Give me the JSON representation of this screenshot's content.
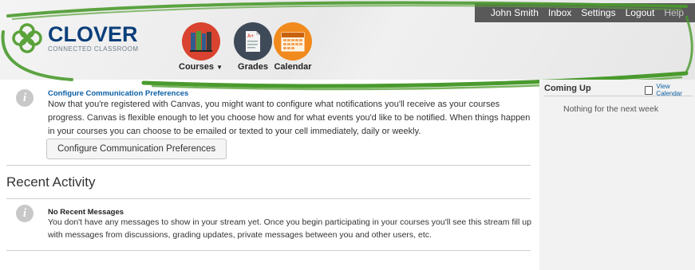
{
  "top_nav": {
    "user": "John Smith",
    "inbox": "Inbox",
    "settings": "Settings",
    "logout": "Logout",
    "help": "Help"
  },
  "logo": {
    "title": "CLOVER",
    "subtitle": "CONNECTED CLASSROOM"
  },
  "menu": {
    "courses": "Courses",
    "grades": "Grades",
    "calendar": "Calendar"
  },
  "notice": {
    "title": "Configure Communication Preferences",
    "body": "Now that you're registered with Canvas, you might want to configure what notifications you'll receive as your courses progress. Canvas is flexible enough to let you choose how and for what events you'd like to be notified. When things happen in your courses you can choose to be emailed or texted to your cell immediately, daily or weekly.",
    "button": "Configure Communication Preferences"
  },
  "recent_activity": {
    "title": "Recent Activity",
    "message_title": "No Recent Messages",
    "message_body": "You don't have any messages to show in your stream yet. Once you begin participating in your courses you'll see this stream fill up with messages from discussions, grading updates, private messages between you and other users, etc."
  },
  "sidebar": {
    "coming_up": "Coming Up",
    "view_calendar": "View Calendar",
    "nothing": "Nothing for the next week"
  },
  "colors": {
    "brand_navy": "#0b3f7a",
    "link_blue": "#0b5fa5",
    "accent_green": "#4a9a2e",
    "courses_red": "#d9432f",
    "grades_slate": "#3f4a59",
    "calendar_orange": "#f18a1c"
  }
}
